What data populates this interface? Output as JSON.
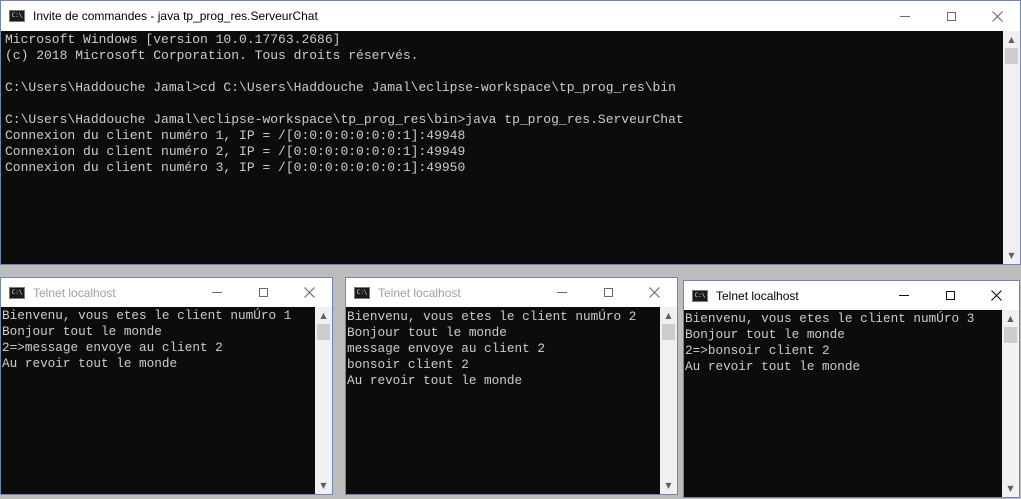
{
  "main_window": {
    "title": "Invite de commandes - java  tp_prog_res.ServeurChat",
    "lines": [
      "Microsoft Windows [version 10.0.17763.2686]",
      "(c) 2018 Microsoft Corporation. Tous droits réservés.",
      "",
      "C:\\Users\\Haddouche Jamal>cd C:\\Users\\Haddouche Jamal\\eclipse-workspace\\tp_prog_res\\bin",
      "",
      "C:\\Users\\Haddouche Jamal\\eclipse-workspace\\tp_prog_res\\bin>java tp_prog_res.ServeurChat",
      "Connexion du client numéro 1, IP = /[0:0:0:0:0:0:0:1]:49948",
      "Connexion du client numéro 2, IP = /[0:0:0:0:0:0:0:1]:49949",
      "Connexion du client numéro 3, IP = /[0:0:0:0:0:0:0:1]:49950"
    ]
  },
  "telnet_windows": [
    {
      "title": "Telnet localhost",
      "lines": [
        "Bienvenu, vous etes le client numÚro 1",
        "Bonjour tout le monde",
        "2=>message envoye au client 2",
        "Au revoir tout le monde"
      ]
    },
    {
      "title": "Telnet localhost",
      "lines": [
        "Bienvenu, vous etes le client numÚro 2",
        "Bonjour tout le monde",
        "message envoye au client 2",
        "bonsoir client 2",
        "Au revoir tout le monde"
      ]
    },
    {
      "title": "Telnet localhost",
      "lines": [
        "Bienvenu, vous etes le client numÚro 3",
        "Bonjour tout le monde",
        "2=>bonsoir client 2",
        "Au revoir tout le monde"
      ]
    }
  ],
  "icons": {
    "app": "cmd-console-icon",
    "minimize": "minimize-icon",
    "maximize": "maximize-icon",
    "close": "close-icon",
    "scroll_up": "scroll-up-arrow-icon",
    "scroll_down": "scroll-down-arrow-icon"
  },
  "app_icon_text": "C:\\",
  "colors": {
    "console_bg": "#0c0c0c",
    "console_text": "#cccccc",
    "window_border": "#6f87b8"
  }
}
